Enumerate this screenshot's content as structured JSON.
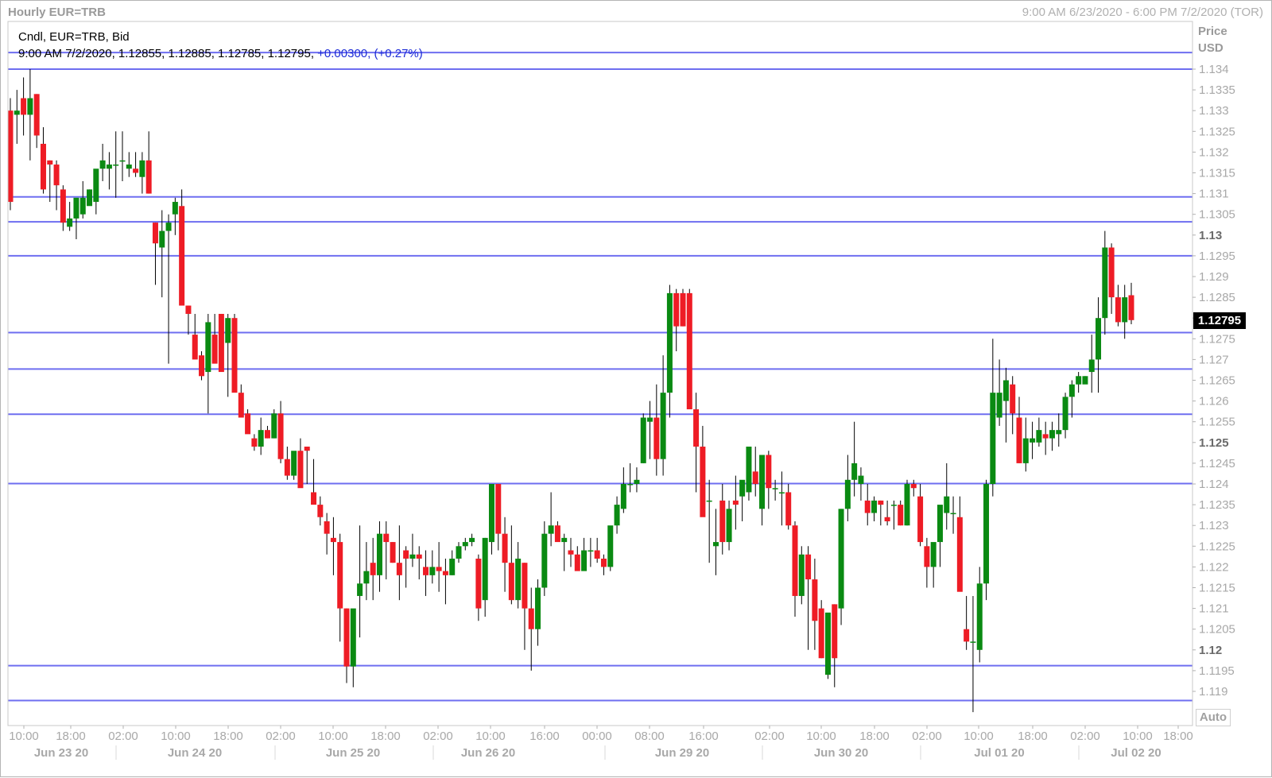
{
  "header": {
    "title": "Hourly EUR=TRB",
    "range": "9:00 AM 6/23/2020 - 6:00 PM 7/2/2020 (TOR)"
  },
  "legend": {
    "line1": "Cndl, EUR=TRB, Bid",
    "ohlc": "9:00 AM 7/2/2020, 1.12855, 1.12885, 1.12785, 1.12795,",
    "change": "+0.00300, (+0.27%)"
  },
  "price_axis": {
    "title": "Price",
    "unit": "USD",
    "last_price": "1.12795",
    "auto_button": "Auto"
  },
  "colors": {
    "up": "#0a8a12",
    "down": "#ee1c25",
    "hline": "#6e6ef0",
    "grid_text": "#a8a8a8",
    "bold_text": "#6a6a6a"
  },
  "chart_data": {
    "type": "candlestick",
    "title": "Hourly EUR=TRB",
    "ylabel": "Price USD",
    "ylim": [
      1.1183,
      1.1342
    ],
    "y_ticks": [
      "1.119",
      "1.1195",
      "1.12",
      "1.1205",
      "1.121",
      "1.1215",
      "1.122",
      "1.1225",
      "1.123",
      "1.1235",
      "1.124",
      "1.1245",
      "1.125",
      "1.1255",
      "1.126",
      "1.1265",
      "1.127",
      "1.1275",
      "1.128",
      "1.1285",
      "1.129",
      "1.1295",
      "1.13",
      "1.1305",
      "1.131",
      "1.1315",
      "1.132",
      "1.1325",
      "1.133",
      "1.1335",
      "1.134"
    ],
    "y_ticks_bold": [
      "1.12",
      "1.125",
      "1.13"
    ],
    "x_time_ticks": [
      "10:00",
      "18:00",
      "02:00",
      "10:00",
      "18:00",
      "02:00",
      "10:00",
      "18:00",
      "02:00",
      "10:00",
      "16:00",
      "00:00",
      "08:00",
      "16:00",
      "02:00",
      "10:00",
      "18:00",
      "02:00",
      "10:00",
      "18:00",
      "02:00",
      "10:00",
      "18:00"
    ],
    "x_date_labels": [
      "Jun 23 20",
      "Jun 24 20",
      "Jun 25 20",
      "Jun 26 20",
      "Jun 29 20",
      "Jun 30 20",
      "Jul 01 20",
      "Jul 02 20"
    ],
    "horizontal_lines": [
      1.1344,
      1.134,
      1.13092,
      1.13032,
      1.1295,
      1.12765,
      1.12677,
      1.12568,
      1.12401,
      1.11962,
      1.11878
    ],
    "candles": [
      [
        1.133,
        1.1333,
        1.1306,
        1.1308
      ],
      [
        1.1329,
        1.1335,
        1.1322,
        1.133
      ],
      [
        1.1333,
        1.1338,
        1.1324,
        1.1329
      ],
      [
        1.1329,
        1.134,
        1.1318,
        1.1333
      ],
      [
        1.1334,
        1.1334,
        1.1321,
        1.1324
      ],
      [
        1.1322,
        1.1326,
        1.131,
        1.1311
      ],
      [
        1.1318,
        1.1318,
        1.1308,
        1.1317
      ],
      [
        1.1317,
        1.1318,
        1.1306,
        1.1312
      ],
      [
        1.1311,
        1.1312,
        1.1301,
        1.1303
      ],
      [
        1.1302,
        1.1308,
        1.1301,
        1.1304
      ],
      [
        1.1304,
        1.1305,
        1.1299,
        1.1309
      ],
      [
        1.1305,
        1.1313,
        1.1304,
        1.1309
      ],
      [
        1.1307,
        1.1311,
        1.1309,
        1.1311
      ],
      [
        1.1308,
        1.1311,
        1.1305,
        1.1316
      ],
      [
        1.1316,
        1.1322,
        1.1313,
        1.1318
      ],
      [
        1.1316,
        1.132,
        1.1311,
        1.1317
      ],
      [
        1.1317,
        1.1325,
        1.1309,
        1.1317
      ],
      [
        1.1318,
        1.1325,
        1.1313,
        1.1318
      ],
      [
        1.1316,
        1.132,
        1.1314,
        1.1317
      ],
      [
        1.1316,
        1.132,
        1.1314,
        1.1315
      ],
      [
        1.1314,
        1.132,
        1.131,
        1.1318
      ],
      [
        1.1318,
        1.1325,
        1.131,
        1.131
      ],
      [
        1.1303,
        1.1303,
        1.1288,
        1.1298
      ],
      [
        1.1297,
        1.1306,
        1.1285,
        1.1301
      ],
      [
        1.1301,
        1.1305,
        1.1269,
        1.1303
      ],
      [
        1.1305,
        1.1309,
        1.13,
        1.1308
      ],
      [
        1.1307,
        1.1311,
        1.1283,
        1.1283
      ],
      [
        1.1283,
        1.1283,
        1.1276,
        1.1281
      ],
      [
        1.1276,
        1.1281,
        1.1272,
        1.127
      ],
      [
        1.1271,
        1.1272,
        1.1265,
        1.1266
      ],
      [
        1.1267,
        1.1281,
        1.1257,
        1.1279
      ],
      [
        1.1276,
        1.1281,
        1.1272,
        1.1269
      ],
      [
        1.1281,
        1.1281,
        1.1271,
        1.1267
      ],
      [
        1.1274,
        1.1281,
        1.1261,
        1.128
      ],
      [
        1.128,
        1.1281,
        1.1263,
        1.1262
      ],
      [
        1.1262,
        1.1264,
        1.1258,
        1.1256
      ],
      [
        1.1257,
        1.1258,
        1.1253,
        1.1252
      ],
      [
        1.1251,
        1.1252,
        1.1248,
        1.1249
      ],
      [
        1.1249,
        1.1256,
        1.1247,
        1.1253
      ],
      [
        1.1253,
        1.1254,
        1.1251,
        1.1251
      ],
      [
        1.1251,
        1.1258,
        1.1251,
        1.1257
      ],
      [
        1.1257,
        1.126,
        1.1245,
        1.1246
      ],
      [
        1.1246,
        1.1249,
        1.1241,
        1.1242
      ],
      [
        1.1242,
        1.1247,
        1.1241,
        1.1248
      ],
      [
        1.1248,
        1.1251,
        1.124,
        1.1239
      ],
      [
        1.1249,
        1.1249,
        1.124,
        1.1248
      ],
      [
        1.1238,
        1.1246,
        1.1236,
        1.1235
      ],
      [
        1.1235,
        1.1237,
        1.123,
        1.1232
      ],
      [
        1.1231,
        1.1233,
        1.1223,
        1.1228
      ],
      [
        1.1227,
        1.1232,
        1.1218,
        1.1226
      ],
      [
        1.1226,
        1.1228,
        1.1202,
        1.121
      ],
      [
        1.121,
        1.121,
        1.1192,
        1.1196
      ],
      [
        1.1196,
        1.1207,
        1.1191,
        1.121
      ],
      [
        1.1213,
        1.123,
        1.1203,
        1.1216
      ],
      [
        1.1216,
        1.1226,
        1.1212,
        1.1219
      ],
      [
        1.1221,
        1.1227,
        1.1212,
        1.1218
      ],
      [
        1.1218,
        1.1231,
        1.1214,
        1.1228
      ],
      [
        1.1228,
        1.1231,
        1.1217,
        1.1226
      ],
      [
        1.1226,
        1.1226,
        1.1221,
        1.1221
      ],
      [
        1.1221,
        1.123,
        1.1212,
        1.1218
      ],
      [
        1.1224,
        1.1225,
        1.1215,
        1.1222
      ],
      [
        1.1222,
        1.1228,
        1.122,
        1.1223
      ],
      [
        1.1223,
        1.1225,
        1.1217,
        1.1222
      ],
      [
        1.122,
        1.1224,
        1.1213,
        1.1218
      ],
      [
        1.1218,
        1.1224,
        1.1216,
        1.122
      ],
      [
        1.122,
        1.1226,
        1.1214,
        1.1219
      ],
      [
        1.1219,
        1.1222,
        1.1211,
        1.1218
      ],
      [
        1.1218,
        1.1224,
        1.1218,
        1.1222
      ],
      [
        1.1222,
        1.1226,
        1.1221,
        1.1225
      ],
      [
        1.1225,
        1.1227,
        1.1224,
        1.1226
      ],
      [
        1.1226,
        1.1228,
        1.1225,
        1.1227
      ],
      [
        1.1222,
        1.1223,
        1.1207,
        1.121
      ],
      [
        1.1212,
        1.1227,
        1.1208,
        1.1227
      ],
      [
        1.1226,
        1.124,
        1.1223,
        1.124
      ],
      [
        1.124,
        1.124,
        1.1224,
        1.1228
      ],
      [
        1.1228,
        1.1232,
        1.1214,
        1.1221
      ],
      [
        1.1221,
        1.123,
        1.1211,
        1.1212
      ],
      [
        1.1212,
        1.1226,
        1.121,
        1.1222
      ],
      [
        1.1221,
        1.1221,
        1.12,
        1.121
      ],
      [
        1.121,
        1.1215,
        1.1195,
        1.1205
      ],
      [
        1.1205,
        1.1217,
        1.1201,
        1.1215
      ],
      [
        1.1215,
        1.1231,
        1.1213,
        1.1228
      ],
      [
        1.1228,
        1.1238,
        1.1225,
        1.123
      ],
      [
        1.123,
        1.1231,
        1.1227,
        1.1226
      ],
      [
        1.1226,
        1.1228,
        1.1219,
        1.1227
      ],
      [
        1.1224,
        1.1227,
        1.122,
        1.1223
      ],
      [
        1.1223,
        1.1225,
        1.1222,
        1.1219
      ],
      [
        1.1219,
        1.1227,
        1.122,
        1.1224
      ],
      [
        1.1224,
        1.1227,
        1.122,
        1.1224
      ],
      [
        1.1224,
        1.1227,
        1.1221,
        1.1222
      ],
      [
        1.1222,
        1.1223,
        1.1218,
        1.122
      ],
      [
        1.122,
        1.1227,
        1.1219,
        1.123
      ],
      [
        1.123,
        1.1237,
        1.1228,
        1.1235
      ],
      [
        1.1234,
        1.1244,
        1.1233,
        1.124
      ],
      [
        1.124,
        1.1245,
        1.1238,
        1.124
      ],
      [
        1.124,
        1.1244,
        1.1238,
        1.1241
      ],
      [
        1.1245,
        1.1257,
        1.1245,
        1.1256
      ],
      [
        1.1255,
        1.126,
        1.1246,
        1.1256
      ],
      [
        1.1256,
        1.1264,
        1.1242,
        1.1246
      ],
      [
        1.1246,
        1.1271,
        1.1242,
        1.1262
      ],
      [
        1.1262,
        1.1288,
        1.1256,
        1.1286
      ],
      [
        1.1286,
        1.1287,
        1.1272,
        1.1278
      ],
      [
        1.1286,
        1.1287,
        1.1278,
        1.1278
      ],
      [
        1.1286,
        1.1287,
        1.1258,
        1.1258
      ],
      [
        1.1258,
        1.1262,
        1.1238,
        1.1249
      ],
      [
        1.1249,
        1.1254,
        1.1233,
        1.1232
      ],
      [
        1.1236,
        1.1241,
        1.1221,
        1.1236
      ],
      [
        1.1225,
        1.1234,
        1.1218,
        1.1226
      ],
      [
        1.1236,
        1.124,
        1.1223,
        1.1226
      ],
      [
        1.1226,
        1.1236,
        1.1224,
        1.1234
      ],
      [
        1.1236,
        1.1242,
        1.1229,
        1.1235
      ],
      [
        1.1237,
        1.124,
        1.1231,
        1.1241
      ],
      [
        1.1238,
        1.1248,
        1.1236,
        1.1249
      ],
      [
        1.1243,
        1.1249,
        1.1237,
        1.124
      ],
      [
        1.1234,
        1.1245,
        1.123,
        1.1247
      ],
      [
        1.1247,
        1.1248,
        1.1234,
        1.1239
      ],
      [
        1.1239,
        1.1241,
        1.1236,
        1.1239
      ],
      [
        1.1238,
        1.1243,
        1.123,
        1.1238
      ],
      [
        1.1238,
        1.124,
        1.1229,
        1.123
      ],
      [
        1.123,
        1.1231,
        1.1208,
        1.1213
      ],
      [
        1.1213,
        1.1225,
        1.1211,
        1.1223
      ],
      [
        1.1223,
        1.1225,
        1.12,
        1.1217
      ],
      [
        1.1217,
        1.1222,
        1.12,
        1.1207
      ],
      [
        1.121,
        1.1212,
        1.1198,
        1.1198
      ],
      [
        1.1194,
        1.12,
        1.1193,
        1.1209
      ],
      [
        1.1211,
        1.1211,
        1.1191,
        1.1198
      ],
      [
        1.121,
        1.1234,
        1.1206,
        1.1234
      ],
      [
        1.1234,
        1.1247,
        1.1231,
        1.1241
      ],
      [
        1.1241,
        1.1255,
        1.1237,
        1.1245
      ],
      [
        1.124,
        1.1244,
        1.1236,
        1.1242
      ],
      [
        1.1236,
        1.124,
        1.123,
        1.1233
      ],
      [
        1.1233,
        1.1237,
        1.1231,
        1.1236
      ],
      [
        1.1236,
        1.1236,
        1.123,
        1.1235
      ],
      [
        1.1232,
        1.1236,
        1.123,
        1.1231
      ],
      [
        1.1235,
        1.1236,
        1.1229,
        1.1235
      ],
      [
        1.1235,
        1.1236,
        1.123,
        1.123
      ],
      [
        1.123,
        1.1241,
        1.123,
        1.124
      ],
      [
        1.124,
        1.1241,
        1.1237,
        1.1239
      ],
      [
        1.1237,
        1.124,
        1.1225,
        1.1226
      ],
      [
        1.1225,
        1.1227,
        1.1215,
        1.122
      ],
      [
        1.122,
        1.1225,
        1.1215,
        1.1226
      ],
      [
        1.1226,
        1.1234,
        1.122,
        1.1235
      ],
      [
        1.1233,
        1.1245,
        1.1229,
        1.1237
      ],
      [
        1.1233,
        1.1237,
        1.1228,
        1.1233
      ],
      [
        1.1232,
        1.1237,
        1.1228,
        1.1214
      ],
      [
        1.1205,
        1.1213,
        1.12,
        1.1202
      ],
      [
        1.1202,
        1.1213,
        1.1185,
        1.1202
      ],
      [
        1.12,
        1.122,
        1.1197,
        1.1216
      ],
      [
        1.1216,
        1.1241,
        1.1212,
        1.124
      ],
      [
        1.124,
        1.1275,
        1.1237,
        1.1262
      ],
      [
        1.1256,
        1.127,
        1.1254,
        1.1262
      ],
      [
        1.126,
        1.1268,
        1.125,
        1.1265
      ],
      [
        1.1264,
        1.1266,
        1.1252,
        1.1257
      ],
      [
        1.1256,
        1.1261,
        1.1245,
        1.1245
      ],
      [
        1.1245,
        1.1256,
        1.1243,
        1.1251
      ],
      [
        1.125,
        1.1255,
        1.1246,
        1.1251
      ],
      [
        1.125,
        1.1256,
        1.1249,
        1.1253
      ],
      [
        1.1252,
        1.1255,
        1.1247,
        1.1251
      ],
      [
        1.1251,
        1.1255,
        1.1248,
        1.1253
      ],
      [
        1.1252,
        1.1257,
        1.1249,
        1.1253
      ],
      [
        1.1253,
        1.1262,
        1.1251,
        1.1261
      ],
      [
        1.1261,
        1.1265,
        1.1256,
        1.1264
      ],
      [
        1.1264,
        1.1267,
        1.1262,
        1.1266
      ],
      [
        1.1264,
        1.1266,
        1.1265,
        1.1266
      ],
      [
        1.1267,
        1.1276,
        1.1262,
        1.127
      ],
      [
        1.127,
        1.1285,
        1.1262,
        1.128
      ],
      [
        1.128,
        1.1301,
        1.1276,
        1.1297
      ],
      [
        1.1297,
        1.1298,
        1.1281,
        1.1285
      ],
      [
        1.1285,
        1.1288,
        1.1278,
        1.1279
      ],
      [
        1.1279,
        1.1288,
        1.1275,
        1.1285
      ],
      [
        1.12855,
        1.12885,
        1.12785,
        1.12795
      ]
    ]
  }
}
